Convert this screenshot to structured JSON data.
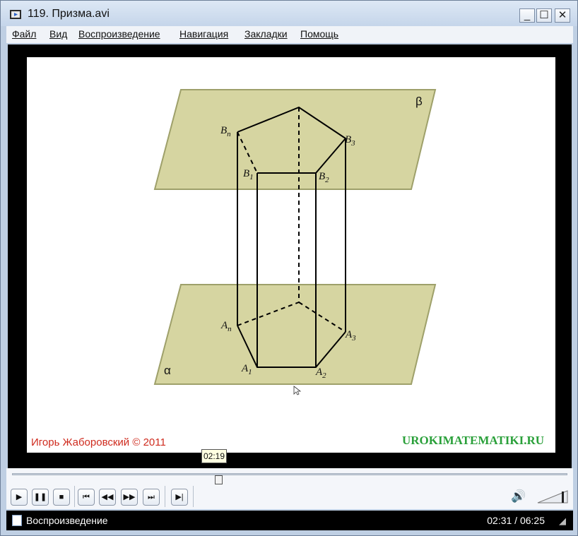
{
  "window": {
    "title": "119. Призма.avi"
  },
  "titlebar_buttons": {
    "minimize": "_",
    "maximize": "☐",
    "close": "✕"
  },
  "menu": [
    "Файл",
    "Вид",
    "Воспроизведение",
    "Навигация",
    "Закладки",
    "Помощь"
  ],
  "slide": {
    "labels": {
      "beta": "β",
      "alpha": "α",
      "Bn": "B",
      "Bn_sub": "n",
      "B1": "B",
      "B1_sub": "1",
      "B2": "B",
      "B2_sub": "2",
      "B3": "B",
      "B3_sub": "3",
      "An": "A",
      "An_sub": "n",
      "A1": "A",
      "A1_sub": "1",
      "A2": "A",
      "A2_sub": "2",
      "A3": "A",
      "A3_sub": "3"
    },
    "credit": "Игорь Жаборовский © 2011",
    "site": "UROKIMATEMATIKI.RU",
    "colors": {
      "plane": "#d6d5a1",
      "plane_border": "#9ea06a",
      "credit": "#cf2b1e",
      "site": "#2aa03a"
    }
  },
  "seek": {
    "tooltip": "02:19",
    "progress": 0.37
  },
  "controls": {
    "play": "▶",
    "pause": "❚❚",
    "stop": "■",
    "prev": "⏮",
    "rewind": "◀◀",
    "forward": "▶▶",
    "next": "⏭",
    "frame": "▶|",
    "volume_level": 0.85
  },
  "status": {
    "text": "Воспроизведение",
    "time": "02:31 / 06:25"
  }
}
